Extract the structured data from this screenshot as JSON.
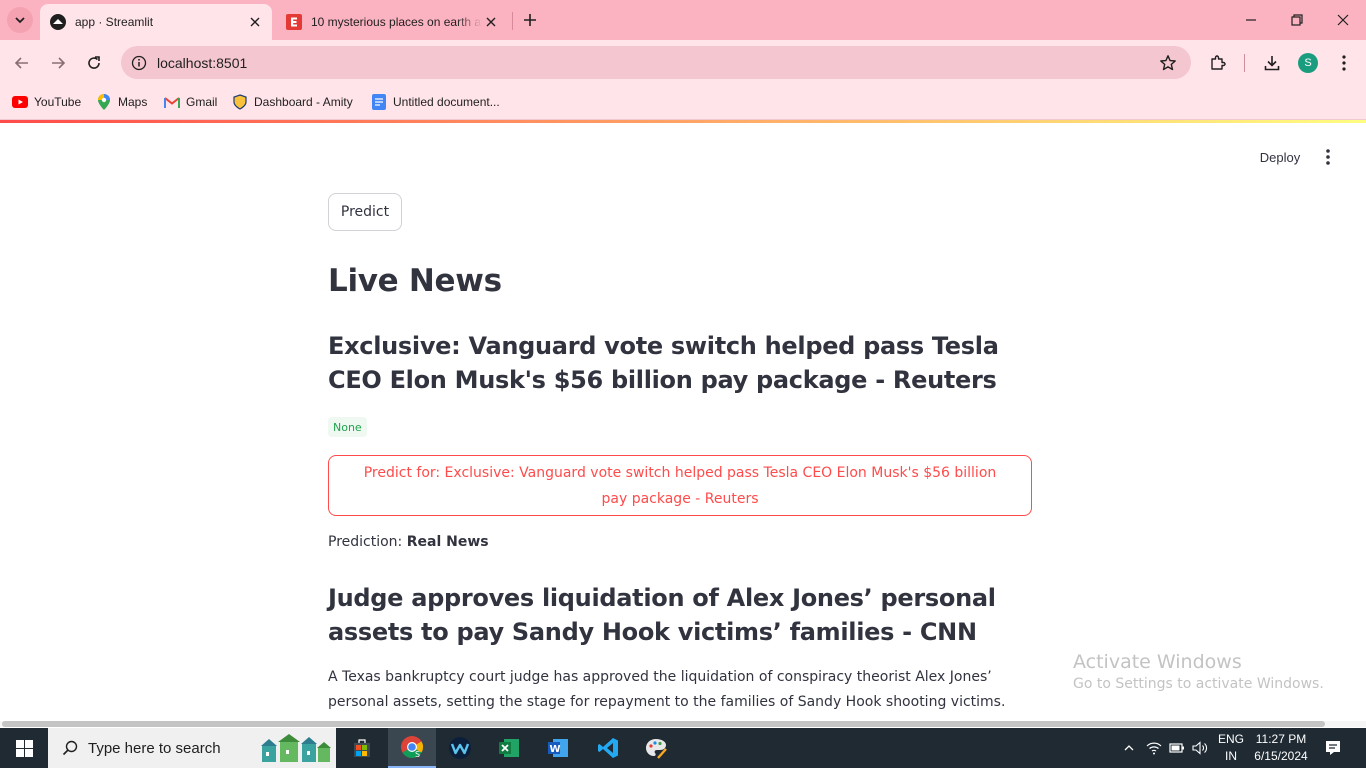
{
  "browser": {
    "tabs": [
      {
        "title": "app · Streamlit",
        "active": true
      },
      {
        "title": "10 mysterious places on earth a",
        "active": false
      }
    ],
    "url": "localhost:8501",
    "profile_initial": "S",
    "bookmarks": [
      {
        "label": "YouTube",
        "icon": "youtube-icon"
      },
      {
        "label": "Maps",
        "icon": "maps-icon"
      },
      {
        "label": "Gmail",
        "icon": "gmail-icon"
      },
      {
        "label": "Dashboard - Amity",
        "icon": "amity-icon"
      },
      {
        "label": "Untitled document...",
        "icon": "docs-icon"
      }
    ],
    "accent_color": "#fbb3c1"
  },
  "streamlit": {
    "deploy_label": "Deploy",
    "predict_button": "Predict",
    "page_title": "Live News",
    "articles": [
      {
        "headline": "Exclusive: Vanguard vote switch helped pass Tesla CEO Elon Musk's $56 billion pay package - Reuters",
        "description": "None",
        "predict_button": "Predict for: Exclusive: Vanguard vote switch helped pass Tesla CEO Elon Musk's $56 billion pay package - Reuters",
        "prediction_label": "Prediction:",
        "prediction_value": "Real News"
      },
      {
        "headline": "Judge approves liquidation of Alex Jones’ personal assets to pay Sandy Hook victims’ families - CNN",
        "description": "A Texas bankruptcy court judge has approved the liquidation of conspiracy theorist Alex Jones’ personal assets, setting the stage for repayment to the families of Sandy Hook shooting victims."
      }
    ],
    "primary_color": "#ff4b4b"
  },
  "watermark": {
    "line1": "Activate Windows",
    "line2": "Go to Settings to activate Windows."
  },
  "taskbar": {
    "search_placeholder": "Type here to search",
    "language": "ENG",
    "region": "IN",
    "time": "11:27 PM",
    "date": "6/15/2024"
  }
}
